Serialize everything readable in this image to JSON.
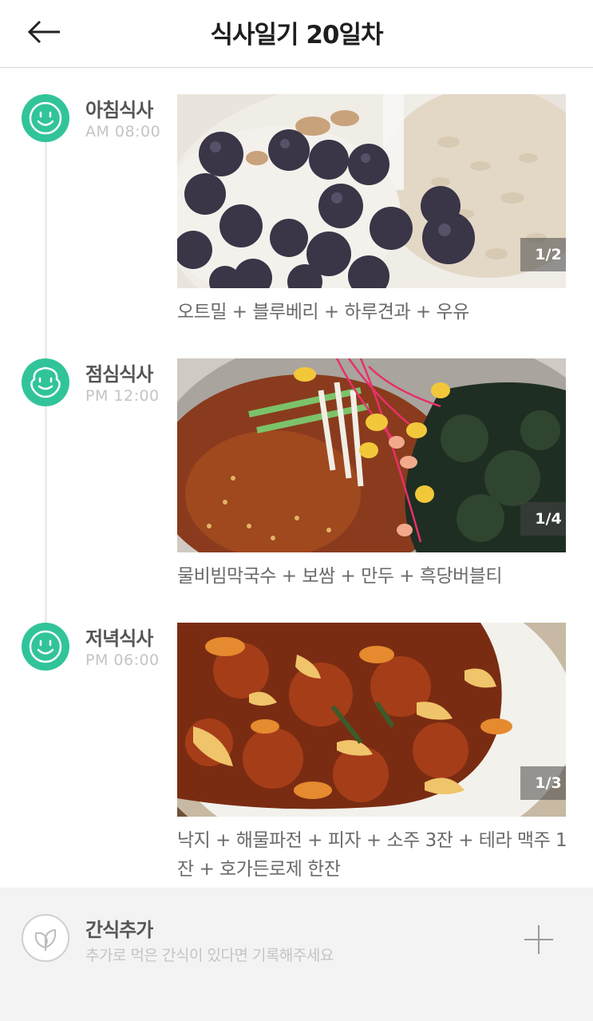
{
  "header": {
    "title": "식사일기 20일차",
    "back_icon": "arrow-left-icon"
  },
  "colors": {
    "accent": "#31c49a",
    "muted_text": "#c4c4c4",
    "body_text": "#6a6a6a",
    "snack_bg": "#f3f3f3"
  },
  "meals": [
    {
      "name": "아침식사",
      "time": "AM 08:00",
      "icon": "smile-face-icon",
      "counter": "1/2",
      "description": "오트밀 + 블루베리 + 하루견과 + 우유"
    },
    {
      "name": "점심식사",
      "time": "PM 12:00",
      "icon": "chubby-face-icon",
      "counter": "1/4",
      "description": "물비빔막국수 + 보쌈 + 만두 + 흑당버블티"
    },
    {
      "name": "저녁식사",
      "time": "PM 06:00",
      "icon": "smile-face-icon",
      "counter": "1/3",
      "description": "낙지 + 해물파전 + 피자 + 소주 3잔 + 테라 맥주 1잔 + 호가든로제 한잔"
    }
  ],
  "snack": {
    "title": "간식추가",
    "subtitle": "추가로 먹은 간식이 있다면 기록해주세요",
    "icon": "leaf-icon",
    "add_icon": "plus-icon"
  }
}
